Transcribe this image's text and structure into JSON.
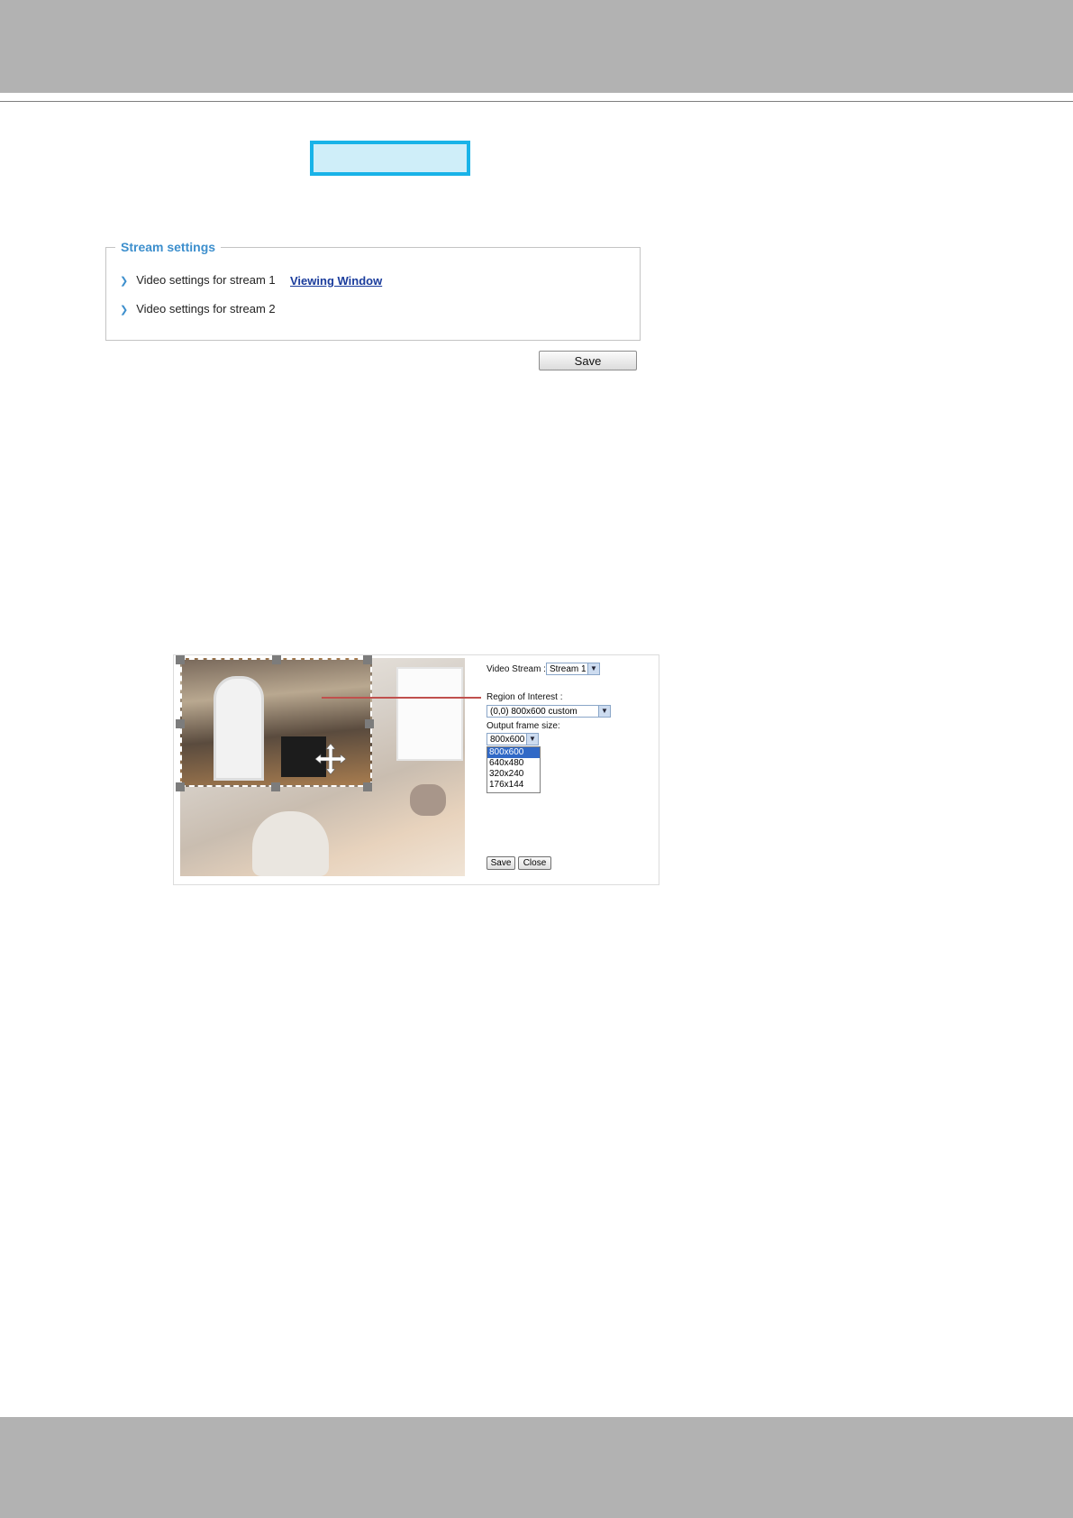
{
  "stream_settings": {
    "legend": "Stream settings",
    "rows": [
      {
        "label": "Video settings for stream 1"
      },
      {
        "label": "Video settings for stream 2"
      }
    ],
    "viewing_window_link": "Viewing Window",
    "save_label": "Save"
  },
  "roi_window": {
    "video_stream_label": "Video Stream :",
    "video_stream_value": "Stream 1",
    "region_label": "Region of Interest :",
    "region_value": "(0,0) 800x600 custom",
    "output_label": "Output frame size:",
    "output_value": "800x600",
    "output_options": [
      "800x600",
      "640x480",
      "320x240",
      "176x144"
    ],
    "selected_option_index": 0,
    "save_label": "Save",
    "close_label": "Close"
  },
  "colors": {
    "accent": "#3d8fcd",
    "title_box_border": "#19b3e8",
    "title_box_fill": "#cfeef9",
    "callout": "#c0504d",
    "band": "#b2b2b2"
  }
}
